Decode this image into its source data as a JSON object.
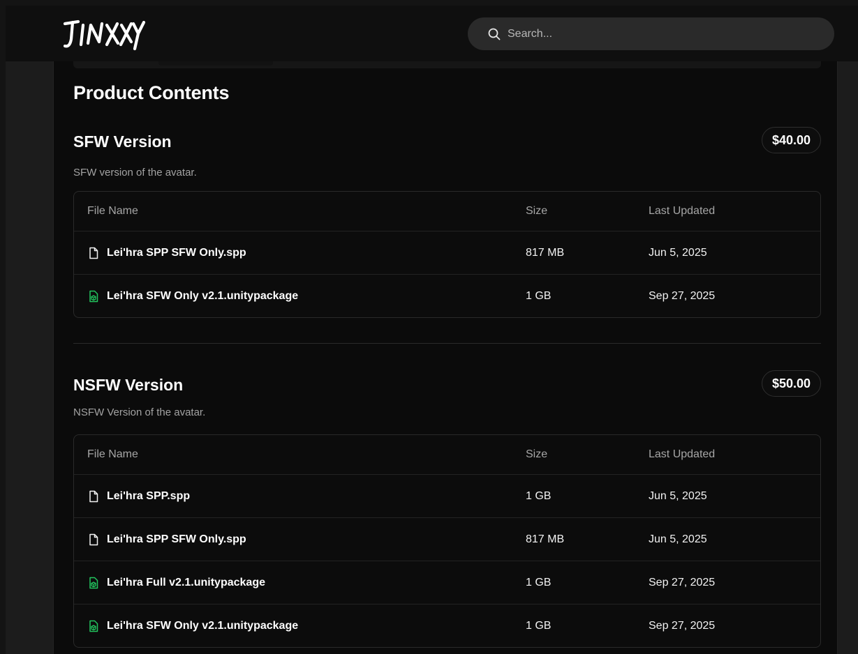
{
  "brand": {
    "logo_text": "JINXXY"
  },
  "search": {
    "placeholder": "Search..."
  },
  "section_title": "Product Contents",
  "table_headers": {
    "name": "File Name",
    "size": "Size",
    "updated": "Last Updated"
  },
  "versions": [
    {
      "name": "SFW Version",
      "price": "$40.00",
      "description": "SFW version of the avatar.",
      "files": [
        {
          "name": "Lei'hra SPP SFW Only.spp",
          "size": "817 MB",
          "updated": "Jun 5, 2025",
          "icon": "file-icon"
        },
        {
          "name": "Lei'hra SFW Only v2.1.unitypackage",
          "size": "1 GB",
          "updated": "Sep 27, 2025",
          "icon": "package-icon"
        }
      ]
    },
    {
      "name": "NSFW Version",
      "price": "$50.00",
      "description": "NSFW Version of the avatar.",
      "files": [
        {
          "name": "Lei'hra SPP.spp",
          "size": "1 GB",
          "updated": "Jun 5, 2025",
          "icon": "file-icon"
        },
        {
          "name": "Lei'hra SPP SFW Only.spp",
          "size": "817 MB",
          "updated": "Jun 5, 2025",
          "icon": "file-icon"
        },
        {
          "name": "Lei'hra Full v2.1.unitypackage",
          "size": "1 GB",
          "updated": "Sep 27, 2025",
          "icon": "package-icon"
        },
        {
          "name": "Lei'hra SFW Only v2.1.unitypackage",
          "size": "1 GB",
          "updated": "Sep 27, 2025",
          "icon": "package-icon"
        }
      ]
    }
  ],
  "colors": {
    "background": "#0b0b0b",
    "package_icon": "#22c55e",
    "muted_text": "#a3a3a3",
    "search_bg": "#2a2a2a"
  }
}
